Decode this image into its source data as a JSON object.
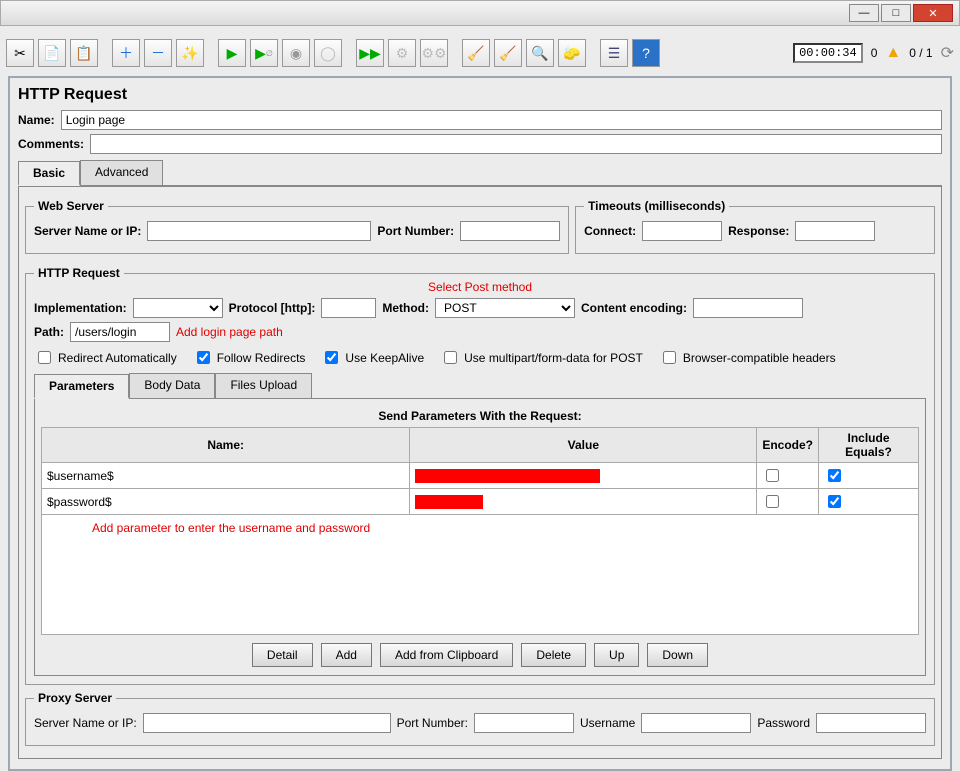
{
  "title": "HTTP Request",
  "name_label": "Name:",
  "name_value": "Login page",
  "comments_label": "Comments:",
  "comments_value": "",
  "tabs_main": {
    "basic": "Basic",
    "advanced": "Advanced"
  },
  "webserver": {
    "legend": "Web Server",
    "server_lbl": "Server Name or IP:",
    "server_val": "",
    "port_lbl": "Port Number:",
    "port_val": ""
  },
  "timeouts": {
    "legend": "Timeouts (milliseconds)",
    "connect_lbl": "Connect:",
    "connect_val": "",
    "response_lbl": "Response:",
    "response_val": ""
  },
  "http": {
    "legend": "HTTP Request",
    "impl_lbl": "Implementation:",
    "impl_val": "",
    "proto_lbl": "Protocol [http]:",
    "proto_val": "",
    "method_lbl": "Method:",
    "method_val": "POST",
    "enc_lbl": "Content encoding:",
    "enc_val": "",
    "path_lbl": "Path:",
    "path_val": "/users/login"
  },
  "anno": {
    "method": "Select Post method",
    "path": "Add login page path",
    "param": "Add parameter to enter the username and password"
  },
  "checks": {
    "redirect_auto": "Redirect Automatically",
    "follow": "Follow Redirects",
    "keepalive": "Use KeepAlive",
    "multipart": "Use multipart/form-data for POST",
    "browsercompat": "Browser-compatible headers"
  },
  "param_tabs": {
    "params": "Parameters",
    "body": "Body Data",
    "files": "Files Upload"
  },
  "param_title": "Send Parameters With the Request:",
  "param_cols": {
    "name": "Name:",
    "value": "Value",
    "encode": "Encode?",
    "include": "Include Equals?"
  },
  "param_rows": [
    {
      "name": "$username$",
      "encode": false,
      "include": true
    },
    {
      "name": "$password$",
      "encode": false,
      "include": true
    }
  ],
  "buttons": {
    "detail": "Detail",
    "add": "Add",
    "clip": "Add from Clipboard",
    "del": "Delete",
    "up": "Up",
    "down": "Down"
  },
  "proxy": {
    "legend": "Proxy Server",
    "server_lbl": "Server Name or IP:",
    "server_val": "",
    "port_lbl": "Port Number:",
    "port_val": "",
    "user_lbl": "Username",
    "user_val": "",
    "pass_lbl": "Password",
    "pass_val": ""
  },
  "toolbar_status": {
    "clock": "00:00:34",
    "left": "0",
    "right": "0 / 1"
  }
}
